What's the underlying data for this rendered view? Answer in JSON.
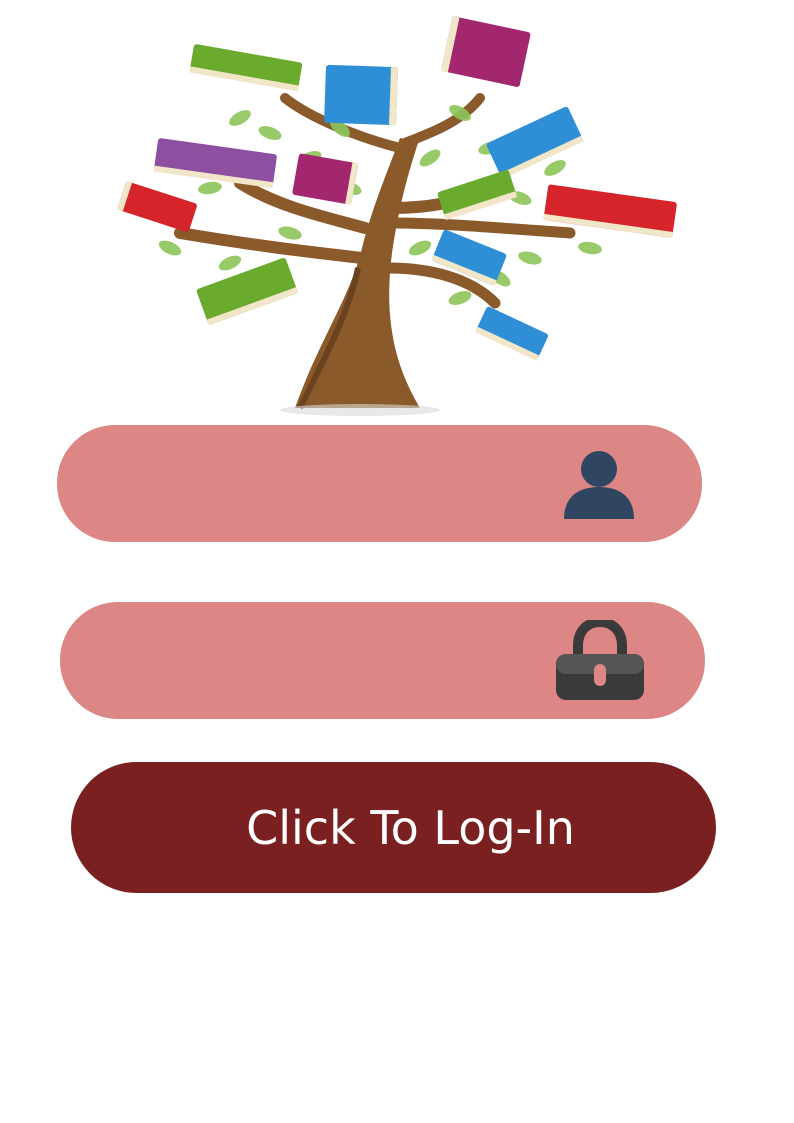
{
  "login": {
    "username": {
      "value": "",
      "placeholder": "",
      "icon": "user-icon"
    },
    "password": {
      "value": "",
      "placeholder": "",
      "icon": "lock-icon"
    },
    "submit_label": "Click To Log-In"
  },
  "colors": {
    "field_bg": "#dc8785",
    "button_bg": "#7a2020",
    "button_text": "#ffffff",
    "icon_user": "#2f4560",
    "icon_lock": "#3a3a3a"
  },
  "logo": {
    "icon": "book-tree-icon"
  }
}
